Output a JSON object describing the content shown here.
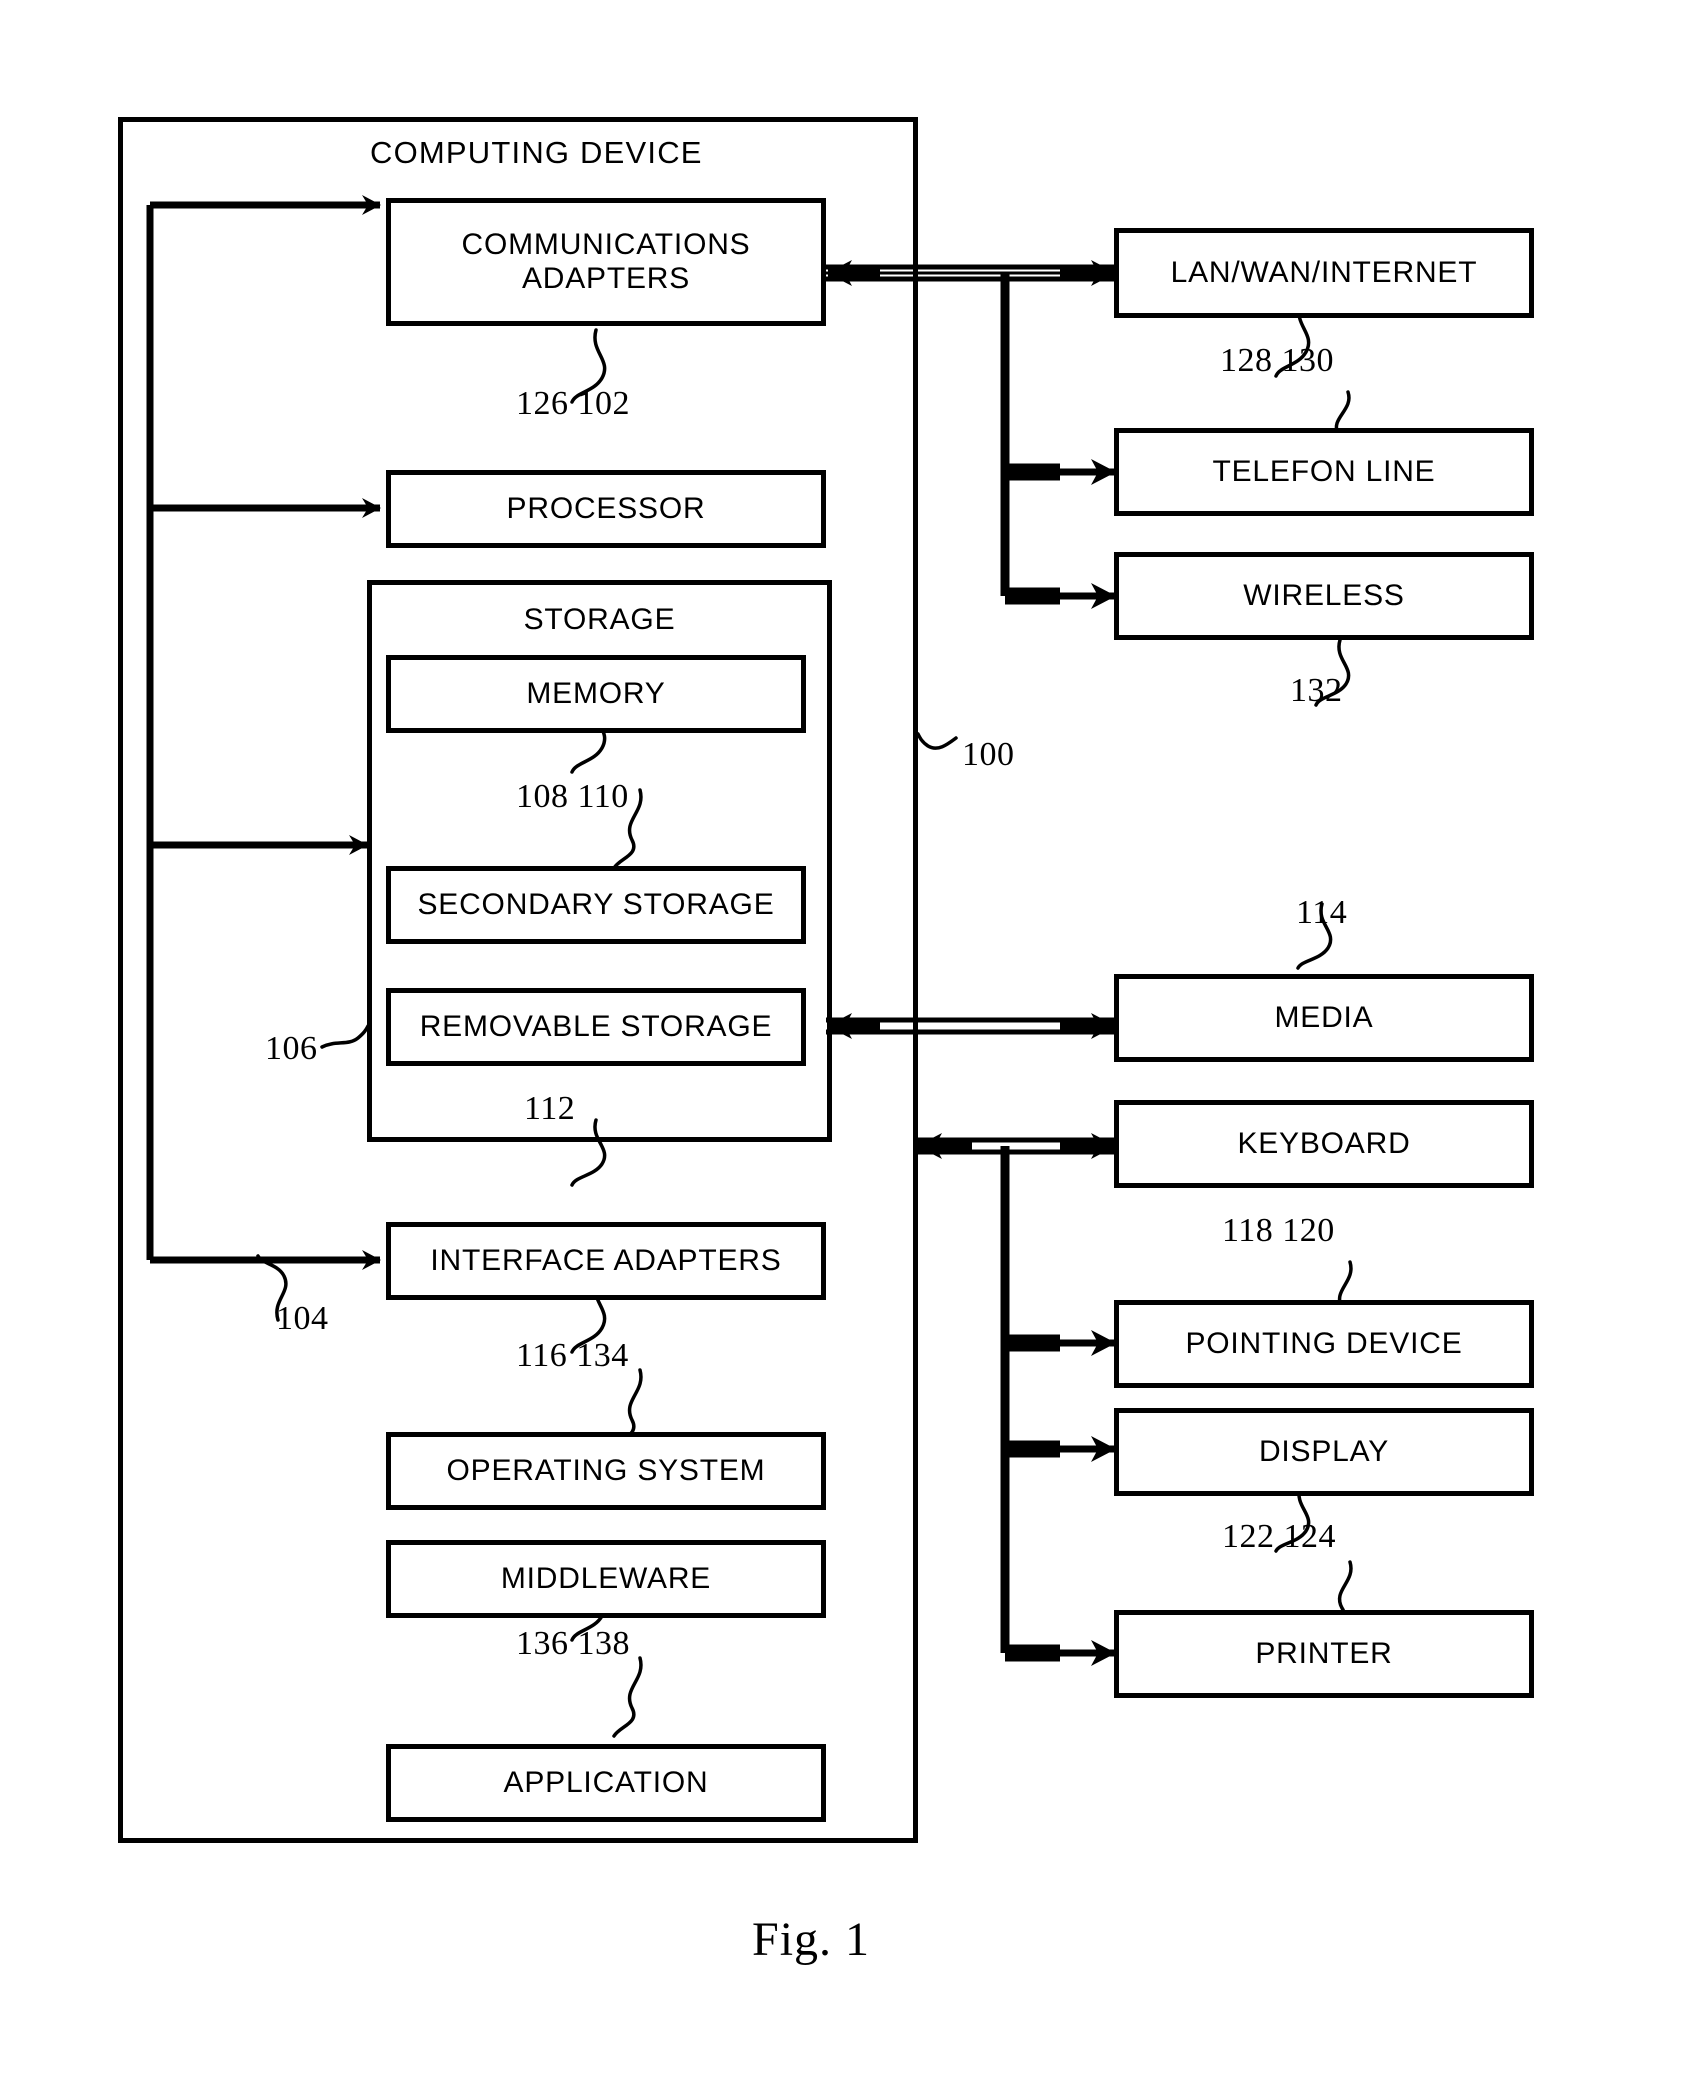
{
  "figure": {
    "caption": "Fig. 1",
    "enclosure_title": "COMPUTING DEVICE",
    "enclosure_ref": "100"
  },
  "device_blocks": [
    {
      "id": "communications-adapters",
      "label": "COMMUNICATIONS\nADAPTERS",
      "refs": "126  102"
    },
    {
      "id": "processor",
      "label": "PROCESSOR",
      "refs": ""
    },
    {
      "id": "storage",
      "label": "STORAGE",
      "refs": "106"
    },
    {
      "id": "memory",
      "label": "MEMORY",
      "refs": "108  110"
    },
    {
      "id": "secondary-storage",
      "label": "SECONDARY STORAGE",
      "refs": ""
    },
    {
      "id": "removable-storage",
      "label": "REMOVABLE STORAGE",
      "refs": "112"
    },
    {
      "id": "interface-adapters",
      "label": "INTERFACE ADAPTERS",
      "refs": "116  134"
    },
    {
      "id": "operating-system",
      "label": "OPERATING SYSTEM",
      "refs": ""
    },
    {
      "id": "middleware",
      "label": "MIDDLEWARE",
      "refs": "136  138"
    },
    {
      "id": "application",
      "label": "APPLICATION",
      "refs": ""
    }
  ],
  "external_blocks": [
    {
      "id": "lan-wan-internet",
      "label": "LAN/WAN/INTERNET",
      "refs": "128  130"
    },
    {
      "id": "telefon-line",
      "label": "TELEFON LINE",
      "refs": ""
    },
    {
      "id": "wireless",
      "label": "WIRELESS",
      "refs": "132"
    },
    {
      "id": "media",
      "label": "MEDIA",
      "refs": "114"
    },
    {
      "id": "keyboard",
      "label": "KEYBOARD",
      "refs": "118  120"
    },
    {
      "id": "pointing-device",
      "label": "POINTING DEVICE",
      "refs": ""
    },
    {
      "id": "display",
      "label": "DISPLAY",
      "refs": "122  124"
    },
    {
      "id": "printer",
      "label": "PRINTER",
      "refs": ""
    }
  ],
  "reference_numerals": {
    "bus_left": "104",
    "comms_adapters": "126  102",
    "memory": "108  110",
    "storage_group": "106",
    "removable_storage": "112",
    "interface_adapters": "116  134",
    "middleware": "136  138",
    "lan_wan_internet": "128  130",
    "wireless": "132",
    "media": "114",
    "keyboard": "118  120",
    "display": "122  124",
    "computing_device": "100"
  },
  "labels": {
    "computing_device": "COMPUTING DEVICE",
    "communications_adapters": "COMMUNICATIONS\nADAPTERS",
    "processor": "PROCESSOR",
    "storage": "STORAGE",
    "memory": "MEMORY",
    "secondary_storage": "SECONDARY STORAGE",
    "removable_storage": "REMOVABLE STORAGE",
    "interface_adapters": "INTERFACE ADAPTERS",
    "operating_system": "OPERATING SYSTEM",
    "middleware": "MIDDLEWARE",
    "application": "APPLICATION",
    "lan_wan_internet": "LAN/WAN/INTERNET",
    "telefon_line": "TELEFON LINE",
    "wireless": "WIRELESS",
    "media": "MEDIA",
    "keyboard": "KEYBOARD",
    "pointing_device": "POINTING DEVICE",
    "display": "DISPLAY",
    "printer": "PRINTER",
    "fig_caption": "Fig. 1"
  },
  "colors": {
    "ink": "#000000",
    "paper": "#ffffff"
  }
}
